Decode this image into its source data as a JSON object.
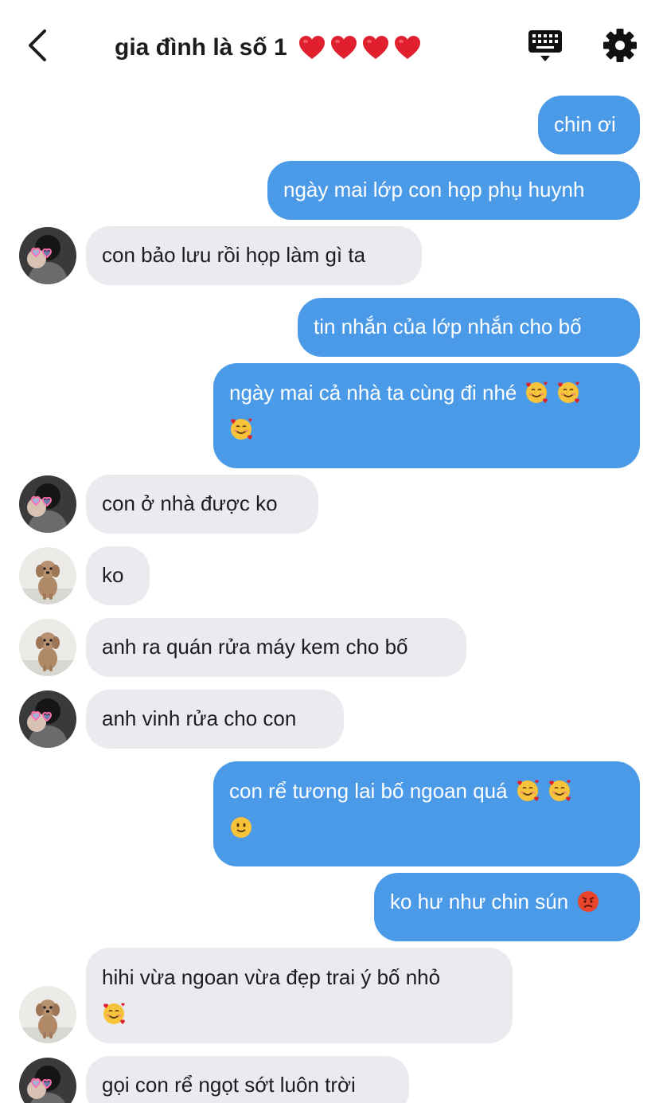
{
  "header": {
    "title": "gia đình là số 1",
    "title_hearts": 4,
    "back_icon": "chevron-left-icon",
    "keyboard_icon": "keyboard-icon",
    "settings_icon": "gear-icon"
  },
  "colors": {
    "outgoing_bubble": "#4a9ae8",
    "incoming_bubble": "#e9ebef",
    "heart": "#e0202e"
  },
  "messages": [
    {
      "dir": "out",
      "text": "chin ơi",
      "emojis": []
    },
    {
      "dir": "out",
      "text": "ngày mai lớp con họp phụ huynh",
      "emojis": []
    },
    {
      "dir": "in",
      "avatar": "person-avatar",
      "text": "con bảo lưu rồi họp làm gì ta",
      "emojis": []
    },
    {
      "dir": "out",
      "text": "tin nhắn của lớp nhắn cho bố",
      "emojis": []
    },
    {
      "dir": "out",
      "text": "ngày mai cả nhà ta cùng đi nhé",
      "emojis": [
        "smiling-face-with-hearts",
        "smiling-face-with-hearts",
        "smiling-face-with-hearts"
      ]
    },
    {
      "dir": "in",
      "avatar": "person-avatar",
      "text": "con ở nhà được ko",
      "emojis": []
    },
    {
      "dir": "in",
      "avatar": "dog-avatar",
      "text": "ko",
      "emojis": []
    },
    {
      "dir": "in",
      "avatar": "dog-avatar",
      "text": "anh ra quán rửa máy kem cho bố",
      "emojis": []
    },
    {
      "dir": "in",
      "avatar": "person-avatar",
      "text": "anh vinh rửa cho con",
      "emojis": []
    },
    {
      "dir": "out",
      "text": "con rể tương lai bố ngoan quá",
      "emojis": [
        "smiling-face-with-hearts",
        "smiling-face-with-hearts",
        "slightly-smiling-face"
      ]
    },
    {
      "dir": "out",
      "text": "ko hư như chin sún",
      "emojis": [
        "angry-face"
      ]
    },
    {
      "dir": "in",
      "avatar": "dog-avatar",
      "text": "hihi vừa ngoan vừa đẹp trai ý bố nhỏ",
      "emojis": [
        "smiling-face-with-hearts"
      ]
    },
    {
      "dir": "in",
      "avatar": "person-avatar",
      "text": "gọi con rể ngọt sớt luôn trời",
      "emojis": []
    }
  ]
}
